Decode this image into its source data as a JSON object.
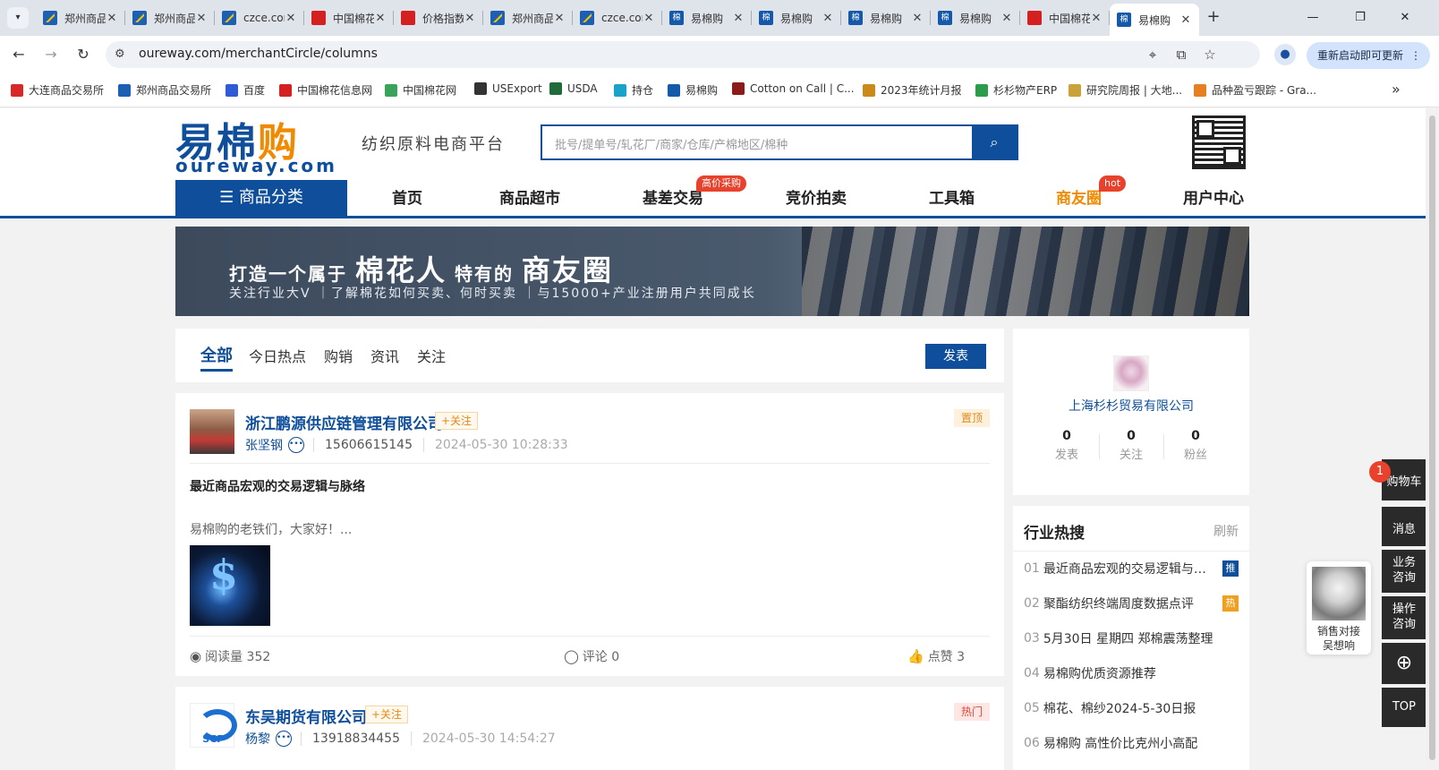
{
  "browser": {
    "tabs": [
      {
        "title": "郑州商品交易所",
        "favicon": "blue"
      },
      {
        "title": "郑州商品交易所",
        "favicon": "blue"
      },
      {
        "title": "czce.com.cn",
        "favicon": "blue"
      },
      {
        "title": "中国棉花信息网",
        "favicon": "red"
      },
      {
        "title": "价格指数",
        "favicon": "red"
      },
      {
        "title": "郑州商品交易所",
        "favicon": "blue"
      },
      {
        "title": "czce.com.cn",
        "favicon": "blue"
      },
      {
        "title": "易棉购",
        "favicon": "mian"
      },
      {
        "title": "易棉购",
        "favicon": "mian"
      },
      {
        "title": "易棉购",
        "favicon": "mian"
      },
      {
        "title": "易棉购",
        "favicon": "mian"
      },
      {
        "title": "中国棉花信息网",
        "favicon": "red"
      },
      {
        "title": "易棉购",
        "favicon": "mian",
        "active": true
      }
    ],
    "url": "oureway.com/merchantCircle/columns",
    "update_label": "重新启动即可更新",
    "bookmarks": [
      {
        "label": "大连商品交易所",
        "color": "#d62a2a"
      },
      {
        "label": "郑州商品交易所",
        "color": "#1c5fb3"
      },
      {
        "label": "百度",
        "color": "#2f5bd6"
      },
      {
        "label": "中国棉花信息网",
        "color": "#d42020"
      },
      {
        "label": "中国棉花网",
        "color": "#3aa35a"
      },
      {
        "label": "USExport",
        "color": "#333333"
      },
      {
        "label": "USDA",
        "color": "#1f6b3a"
      },
      {
        "label": "持仓",
        "color": "#19a3c9"
      },
      {
        "label": "易棉购",
        "color": "#1559a8"
      },
      {
        "label": "Cotton on Call | C...",
        "color": "#8b1a1a"
      },
      {
        "label": "2023年统计月报",
        "color": "#c98a1b"
      },
      {
        "label": "杉杉物产ERP",
        "color": "#2c9c4a"
      },
      {
        "label": "研究院周报 | 大地...",
        "color": "#caa23a"
      },
      {
        "label": "品种盈亏跟踪 - Gra...",
        "color": "#e67e22"
      }
    ]
  },
  "site": {
    "logo_cn": [
      "易棉",
      "购"
    ],
    "logo_en": "oureway.com",
    "slogan": "纺织原料电商平台",
    "search_placeholder": "批号/提单号/轧花厂/商家/仓库/产棉地区/棉种",
    "category_button": "商品分类",
    "nav": [
      "首页",
      "商品超市",
      "基差交易",
      "竞价拍卖",
      "工具箱",
      "商友圈",
      "用户中心"
    ],
    "nav_badges": {
      "basis": "高价采购",
      "circle": "hot"
    }
  },
  "banner": {
    "line1_a": "打造一个属于",
    "line1_b": "棉花人",
    "line1_c": "特有的",
    "line1_d": "商友圈",
    "line2": "关注行业大V ｜了解棉花如何买卖、何时买卖 ｜与15000+产业注册用户共同成长"
  },
  "filter": {
    "tabs": [
      "全部",
      "今日热点",
      "购销",
      "资讯",
      "关注"
    ],
    "post_button": "发表"
  },
  "posts": [
    {
      "company": "浙江鹏源供应链管理有限公司",
      "follow": "+关注",
      "user": "张坚钢",
      "phone": "15606615145",
      "time": "2024-05-30 10:28:33",
      "tag": "置顶",
      "title": "最近商品宏观的交易逻辑与脉络",
      "excerpt": "易棉购的老铁们，大家好！...",
      "views": "阅读量 352",
      "comments": "评论 0",
      "likes": "点赞 3"
    },
    {
      "company": "东吴期货有限公司",
      "follow": "+关注",
      "user": "杨黎",
      "phone": "13918834455",
      "time": "2024-05-30 14:54:27",
      "tag": "热门"
    }
  ],
  "profile": {
    "name": "上海杉杉贸易有限公司",
    "stats": [
      {
        "value": "0",
        "label": "发表"
      },
      {
        "value": "0",
        "label": "关注"
      },
      {
        "value": "0",
        "label": "粉丝"
      }
    ]
  },
  "hot_search": {
    "title": "行业热搜",
    "refresh": "刷新",
    "items": [
      {
        "num": "01",
        "text": "最近商品宏观的交易逻辑与脉络",
        "badge": "推"
      },
      {
        "num": "02",
        "text": "聚酯纺织终端周度数据点评",
        "badge": "热"
      },
      {
        "num": "03",
        "text": "5月30日 星期四 郑棉震荡整理",
        "badge": ""
      },
      {
        "num": "04",
        "text": "易棉购优质资源推荐",
        "badge": ""
      },
      {
        "num": "05",
        "text": "棉花、棉纱2024-5-30日报",
        "badge": ""
      },
      {
        "num": "06",
        "text": "易棉购 高性价比克州小高配",
        "badge": ""
      }
    ]
  },
  "right_toolbar": {
    "cart": "购物车",
    "cart_count": "1",
    "message": "消息",
    "business": "业务咨询",
    "operation": "操作咨询",
    "top": "TOP",
    "sales_label": "销售对接",
    "sales_name": "吴想响"
  }
}
